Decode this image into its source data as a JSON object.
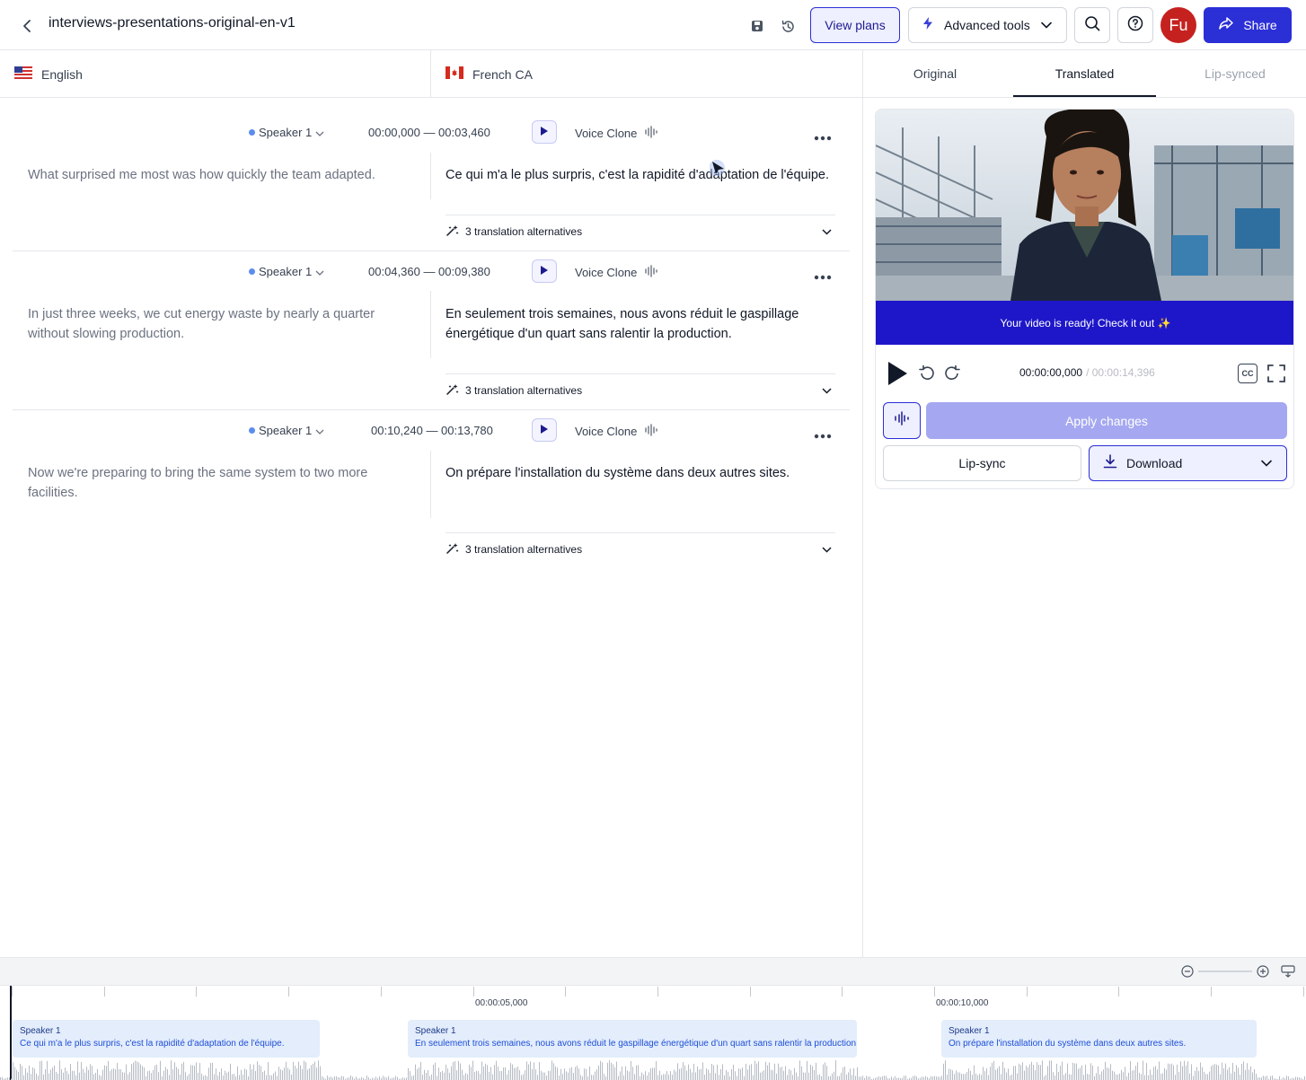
{
  "header": {
    "title": "interviews-presentations-original-en-v1",
    "view_plans": "View plans",
    "advanced_tools": "Advanced tools",
    "avatar_initials": "Fu",
    "share": "Share"
  },
  "languages": {
    "source": "English",
    "target": "French CA"
  },
  "preview_tabs": [
    "Original",
    "Translated",
    "Lip-synced"
  ],
  "segments": [
    {
      "speaker": "Speaker 1",
      "time": "00:00,000 — 00:03,460",
      "voice": "Voice Clone",
      "source": "What surprised me most was how quickly the team adapted.",
      "target": "Ce qui m'a le plus surpris, c'est la rapidité d'adaptation de l'équipe.",
      "alternatives": "3 translation alternatives"
    },
    {
      "speaker": "Speaker 1",
      "time": "00:04,360 — 00:09,380",
      "voice": "Voice Clone",
      "source": "In just three weeks, we cut energy waste by nearly a quarter without slowing production.",
      "target": "En seulement trois semaines, nous avons réduit le gaspillage énergétique d'un quart sans ralentir la production.",
      "alternatives": "3 translation alternatives"
    },
    {
      "speaker": "Speaker 1",
      "time": "00:10,240 — 00:13,780",
      "voice": "Voice Clone",
      "source": "Now we're preparing to bring the same system to two more facilities.",
      "target": "On prépare l'installation du système dans deux autres sites.",
      "alternatives": "3 translation alternatives"
    }
  ],
  "player": {
    "banner": "Your video is ready! Check it out ✨",
    "current_time": "00:00:00,000",
    "total_time": "/ 00:00:14,396",
    "cc": "CC",
    "apply_changes": "Apply changes",
    "lip_sync": "Lip-sync",
    "download": "Download"
  },
  "timeline": {
    "labels": [
      "00:00:05,000",
      "00:00:10,000"
    ],
    "clips": [
      {
        "speaker": "Speaker 1",
        "text": "Ce qui m'a le plus surpris, c'est la rapidité d'adaptation de l'équipe."
      },
      {
        "speaker": "Speaker 1",
        "text": "En seulement trois semaines, nous avons réduit le gaspillage énergétique d'un quart sans ralentir la production."
      },
      {
        "speaker": "Speaker 1",
        "text": "On prépare l'installation du système dans deux autres sites."
      }
    ]
  },
  "colors": {
    "accent": "#2b2fd6",
    "banner": "#1e17c9",
    "apply_disabled": "#a5a8f0",
    "avatar": "#c5221f",
    "clip_bg": "#e3edfb"
  }
}
